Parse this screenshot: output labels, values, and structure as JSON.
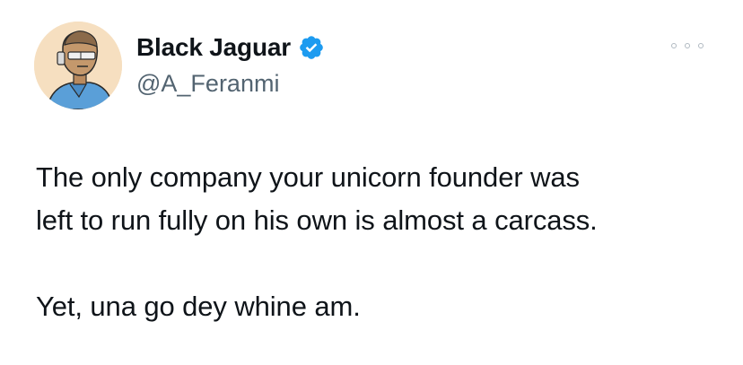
{
  "tweet": {
    "author": {
      "display_name": "Black Jaguar",
      "handle": "@A_Feranmi",
      "verified": true,
      "verified_color": "#1d9bf0",
      "avatar_icon": "avatar-illustration"
    },
    "menu_icon": "more-horizontal-icon",
    "text_lines": [
      "The only company your unicorn founder was",
      "left to run fully on his own is almost a carcass.",
      "Yet, una go dey whine am."
    ]
  }
}
